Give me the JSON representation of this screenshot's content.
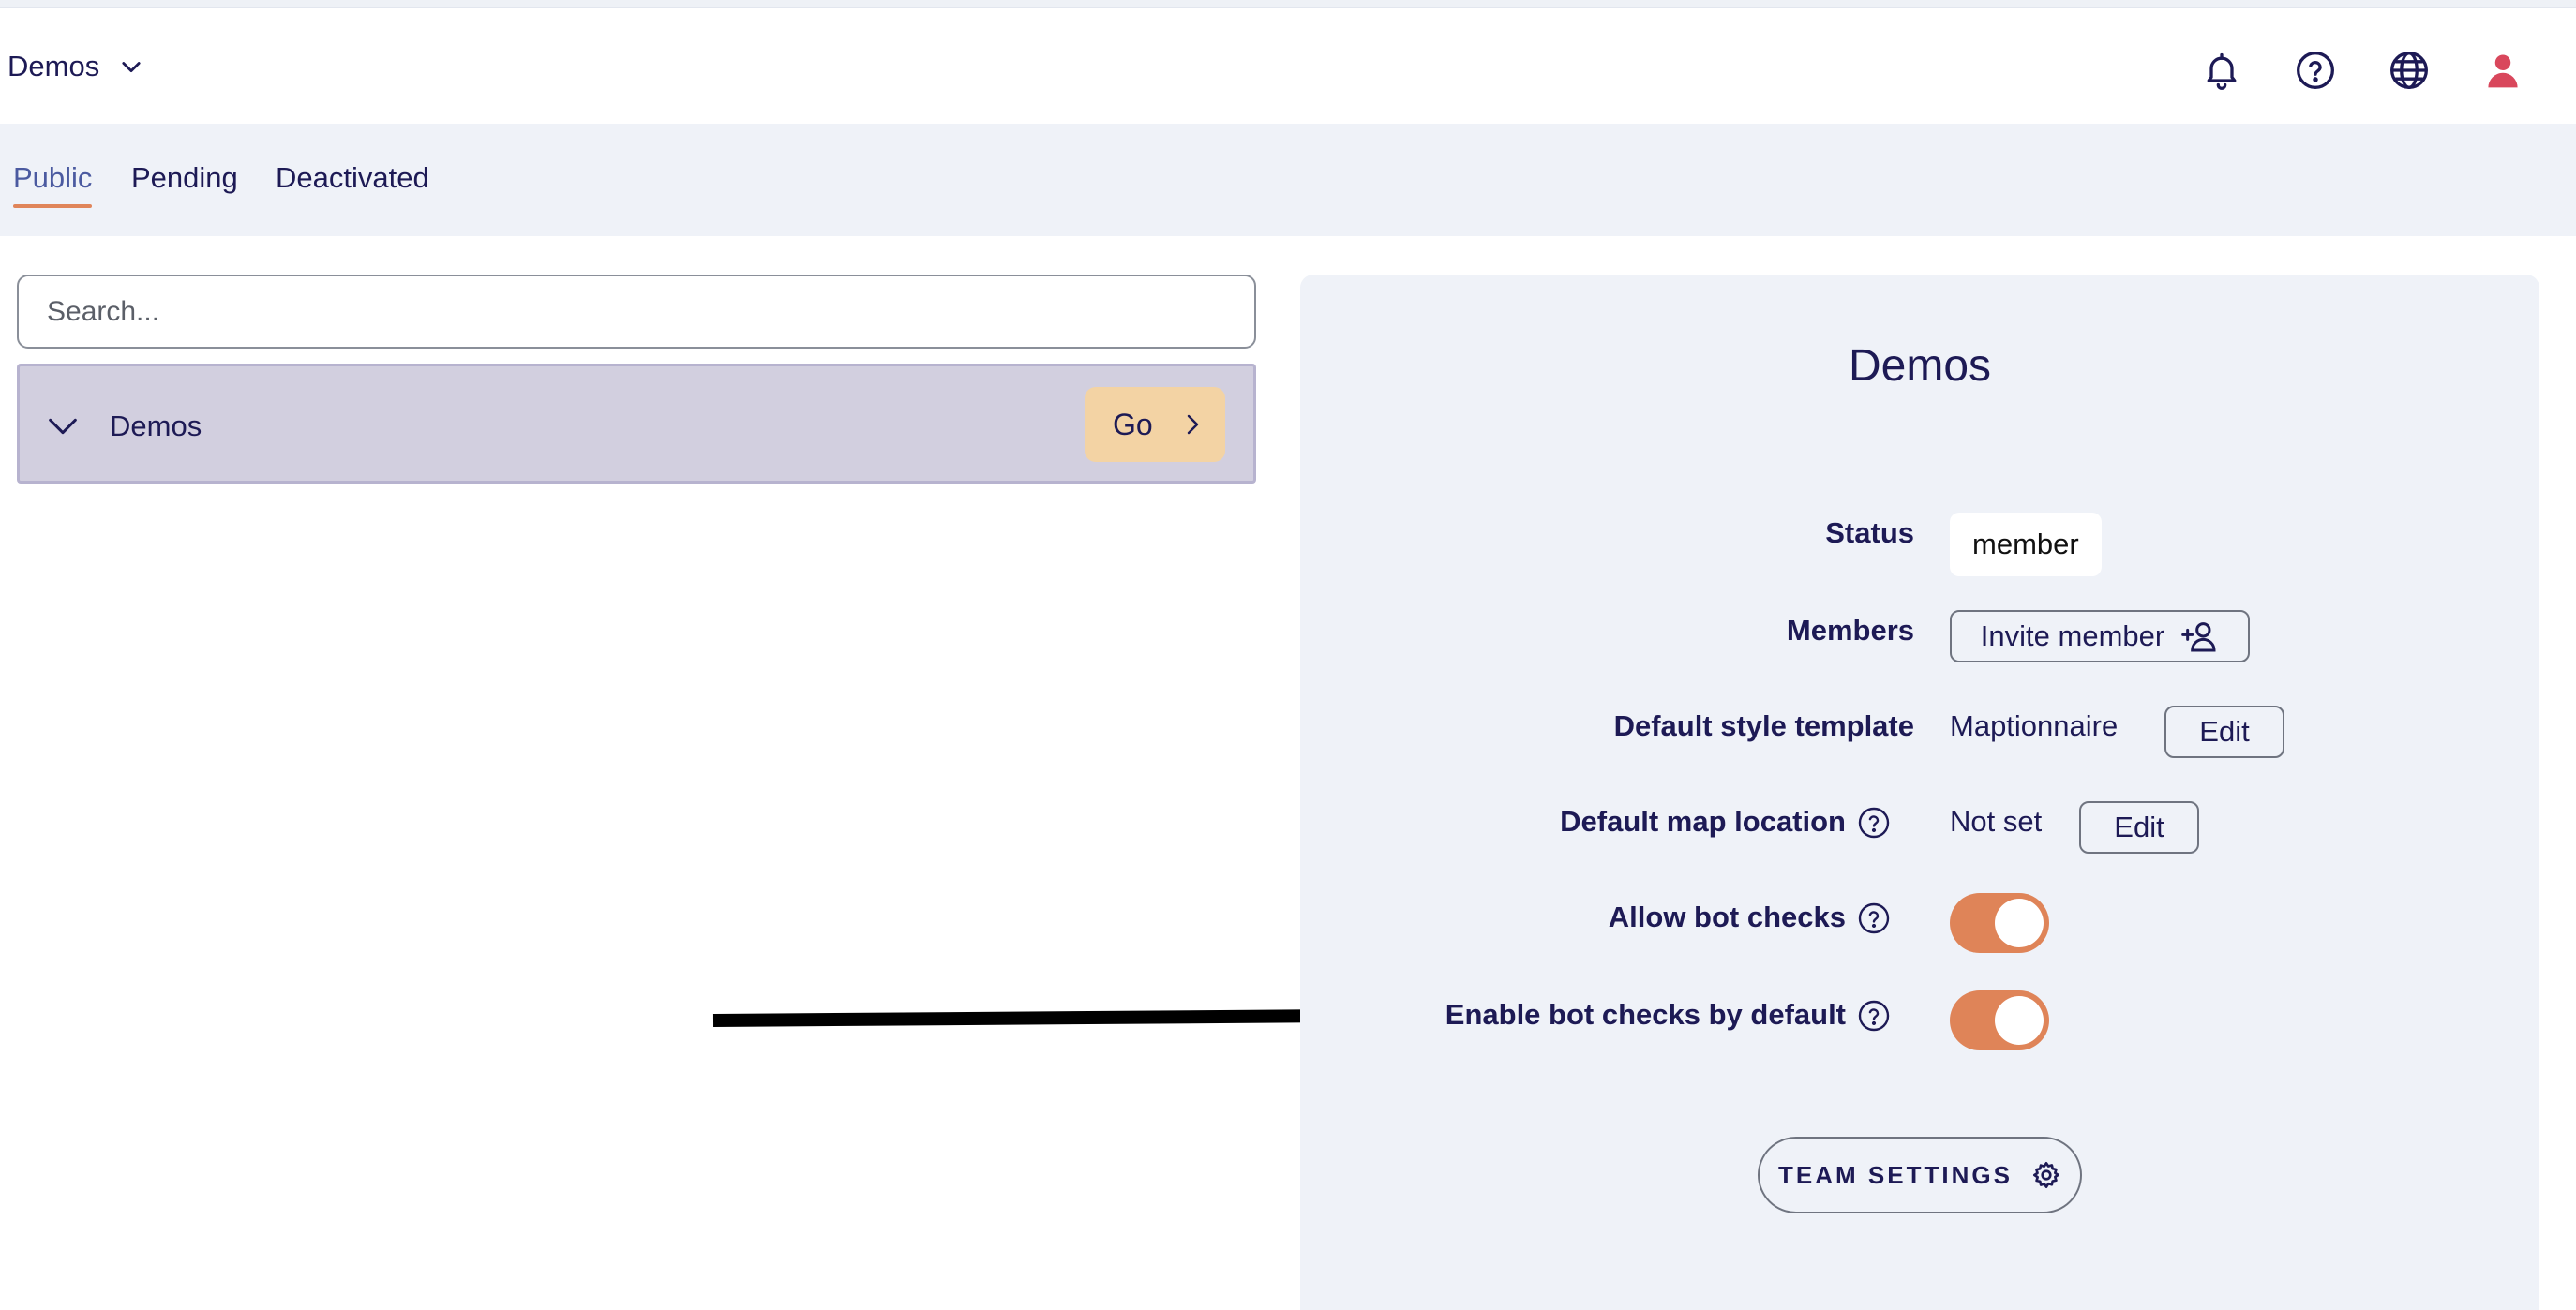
{
  "header": {
    "org_name": "Demos",
    "icons": [
      "bell-icon",
      "help-circle-icon",
      "globe-icon",
      "user-icon"
    ]
  },
  "tabs": [
    {
      "label": "Public",
      "active": true
    },
    {
      "label": "Pending",
      "active": false
    },
    {
      "label": "Deactivated",
      "active": false
    }
  ],
  "search": {
    "placeholder": "Search...",
    "value": ""
  },
  "org_list": [
    {
      "name": "Demos",
      "go_label": "Go"
    }
  ],
  "details": {
    "title": "Demos",
    "status_label": "Status",
    "status_value": "member",
    "members_label": "Members",
    "invite_label": "Invite member",
    "style_label": "Default style template",
    "style_value": "Maptionnaire",
    "style_edit": "Edit",
    "location_label": "Default map location",
    "location_value": "Not set",
    "location_edit": "Edit",
    "bot_checks_label": "Allow bot checks",
    "bot_checks_on": true,
    "bot_default_label": "Enable bot checks by default",
    "bot_default_on": true,
    "team_settings_label": "TEAM SETTINGS"
  },
  "colors": {
    "accent": "#df8458",
    "text": "#1d1a55",
    "selected_row": "#d2cfdf",
    "go_button": "#f3d3a4",
    "user_icon": "#d9475c"
  }
}
